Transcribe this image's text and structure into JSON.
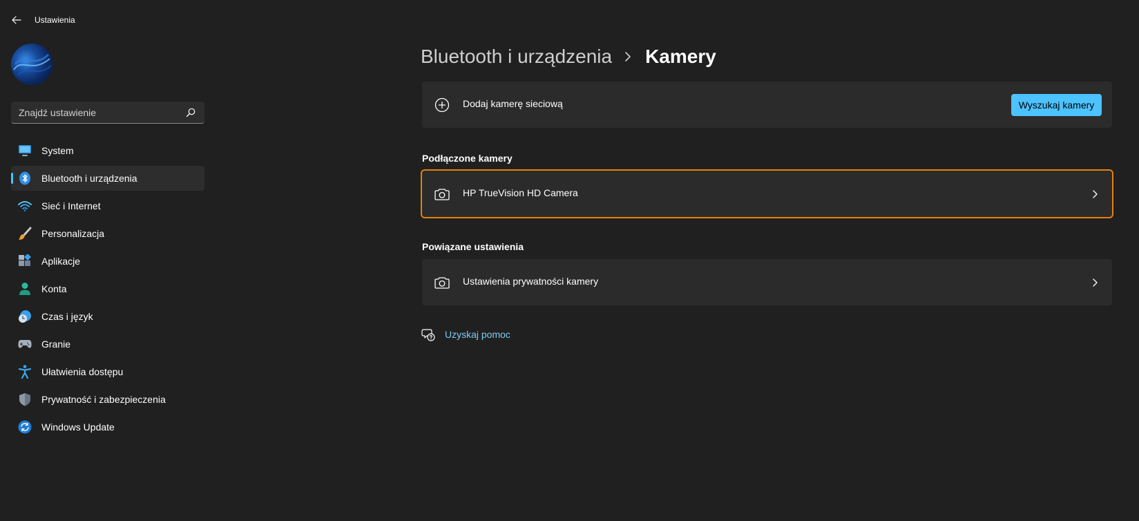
{
  "window": {
    "title": "Ustawienia"
  },
  "search": {
    "placeholder": "Znajdź ustawienie"
  },
  "sidebar": {
    "items": [
      {
        "label": "System",
        "icon": "monitor-icon"
      },
      {
        "label": "Bluetooth i urządzenia",
        "icon": "bluetooth-icon",
        "active": true
      },
      {
        "label": "Sieć i Internet",
        "icon": "wifi-icon"
      },
      {
        "label": "Personalizacja",
        "icon": "brush-icon"
      },
      {
        "label": "Aplikacje",
        "icon": "apps-icon"
      },
      {
        "label": "Konta",
        "icon": "person-icon"
      },
      {
        "label": "Czas i język",
        "icon": "clock-globe-icon"
      },
      {
        "label": "Granie",
        "icon": "gamepad-icon"
      },
      {
        "label": "Ułatwienia dostępu",
        "icon": "accessibility-icon"
      },
      {
        "label": "Prywatność i zabezpieczenia",
        "icon": "shield-icon"
      },
      {
        "label": "Windows Update",
        "icon": "update-icon"
      }
    ]
  },
  "breadcrumb": {
    "parent": "Bluetooth i urządzenia",
    "current": "Kamery"
  },
  "add_camera": {
    "label": "Dodaj kamerę sieciową",
    "button": "Wyszukaj kamery"
  },
  "connected": {
    "title": "Podłączone kamery",
    "cameras": [
      {
        "label": "HP TrueVision HD Camera"
      }
    ]
  },
  "related": {
    "title": "Powiązane ustawienia",
    "items": [
      {
        "label": "Ustawienia prywatności kamery"
      }
    ]
  },
  "help": {
    "label": "Uzyskaj pomoc"
  },
  "colors": {
    "accent": "#4cc2ff",
    "highlight": "#e8820c",
    "background": "#202020",
    "card": "#2b2b2b"
  }
}
